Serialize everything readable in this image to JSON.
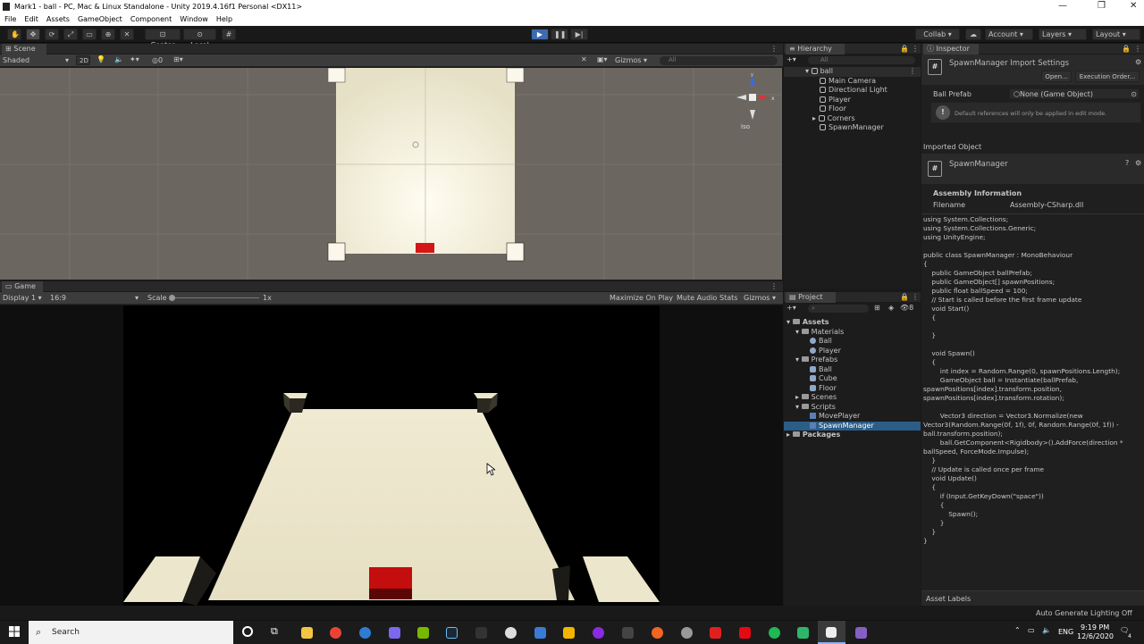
{
  "window": {
    "title": "Mark1 - ball - PC, Mac & Linux Standalone - Unity 2019.4.16f1 Personal <DX11>",
    "minimize": "—",
    "maximize": "❐",
    "close": "✕"
  },
  "menu": [
    "File",
    "Edit",
    "Assets",
    "GameObject",
    "Component",
    "Window",
    "Help"
  ],
  "toolbar": {
    "center": "Center",
    "local": "Local",
    "collab": "Collab ▾",
    "account": "Account",
    "layers": "Layers",
    "layout": "Layout"
  },
  "scene": {
    "tab": "Scene",
    "shading": "Shaded",
    "mode2d": "2D",
    "hidden": "0",
    "gizmos": "Gizmos",
    "search": "All",
    "iso": "Iso"
  },
  "game": {
    "tab": "Game",
    "display": "Display 1",
    "aspect": "16:9",
    "scale_label": "Scale",
    "scale_value": "1x",
    "maximize": "Maximize On Play",
    "mute": "Mute Audio",
    "stats": "Stats",
    "gizmos": "Gizmos"
  },
  "hierarchy": {
    "tab": "Hierarchy",
    "search": "All",
    "root": "ball",
    "items": [
      "Main Camera",
      "Directional Light",
      "Player",
      "Floor",
      "Corners",
      "SpawnManager"
    ]
  },
  "project": {
    "tab": "Project",
    "hidden_count": "8",
    "assets": "Assets",
    "materials": "Materials",
    "mat_items": [
      "Ball",
      "Player"
    ],
    "prefabs": "Prefabs",
    "prefab_items": [
      "Ball",
      "Cube",
      "Floor"
    ],
    "scenes": "Scenes",
    "scripts": "Scripts",
    "script_items": [
      "MovePlayer",
      "SpawnManager"
    ],
    "packages": "Packages"
  },
  "inspector": {
    "tab": "Inspector",
    "title": "SpawnManager Import Settings",
    "open": "Open...",
    "exec_order": "Execution Order...",
    "field_label": "Ball Prefab",
    "field_value": "None (Game Object)",
    "info": "Default references will only be applied in edit mode.",
    "imported_object": "Imported Object",
    "obj_name": "SpawnManager",
    "assembly_info": "Assembly Information",
    "filename_label": "Filename",
    "filename_value": "Assembly-CSharp.dll",
    "asset_labels": "Asset Labels",
    "code": "using System.Collections;\nusing System.Collections.Generic;\nusing UnityEngine;\n\npublic class SpawnManager : MonoBehaviour\n{\n    public GameObject ballPrefab;\n    public GameObject[] spawnPositions;\n    public float ballSpeed = 100;\n    // Start is called before the first frame update\n    void Start()\n    {\n\n    }\n\n    void Spawn()\n    {\n        int index = Random.Range(0, spawnPositions.Length);\n        GameObject ball = Instantiate(ballPrefab,\nspawnPositions[index].transform.position,\nspawnPositions[index].transform.rotation);\n\n        Vector3 direction = Vector3.Normalize(new\nVector3(Random.Range(0f, 1f), 0f, Random.Range(0f, 1f)) -\nball.transform.position);\n        ball.GetComponent<Rigidbody>().AddForce(direction *\nballSpeed, ForceMode.Impulse);\n    }\n    // Update is called once per frame\n    void Update()\n    {\n        if (Input.GetKeyDown(\"space\"))\n        {\n            Spawn();\n        }\n    }\n}"
  },
  "statusbar": {
    "text": "Auto Generate Lighting Off"
  },
  "taskbar": {
    "search": "Search",
    "lang": "ENG",
    "time": "9:19 PM",
    "date": "12/6/2020",
    "notif": "4"
  }
}
